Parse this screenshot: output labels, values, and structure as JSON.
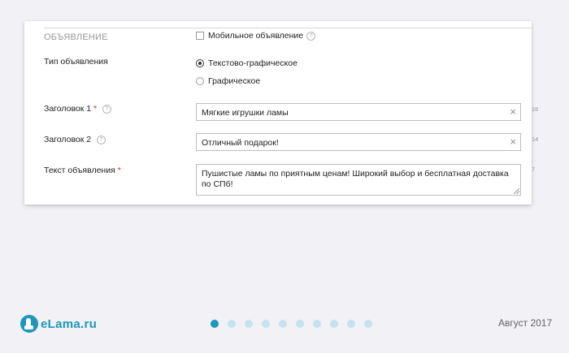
{
  "form": {
    "section_title": "ОБЪЯВЛЕНИЕ",
    "mobile_label": "Мобильное объявление",
    "ad_type_label": "Тип объявления",
    "ad_type_options": [
      "Текстово-графическое",
      "Графическое"
    ],
    "ad_type_selected": "Текстово-графическое",
    "title1_label": "Заголовок 1",
    "title1_value": "Мягкие игрушки ламы",
    "title1_counter": "16",
    "title2_label": "Заголовок 2",
    "title2_value": "Отличный подарок!",
    "title2_counter": "14",
    "text_label": "Текст объявления",
    "text_value": "Пушистые ламы по приятным ценам! Широкий выбор и бесплатная доставка по СПб!",
    "text_counter": "7",
    "required_mark": "*",
    "help_glyph": "?",
    "clear_glyph": "×"
  },
  "footer": {
    "logo_text": "eLama.ru",
    "slide_count": 10,
    "active_slide": 1,
    "date": "Август 2017"
  },
  "colors": {
    "brand": "#1e97b8",
    "dot_inactive": "#c5e3ee",
    "required": "#e0212a"
  }
}
